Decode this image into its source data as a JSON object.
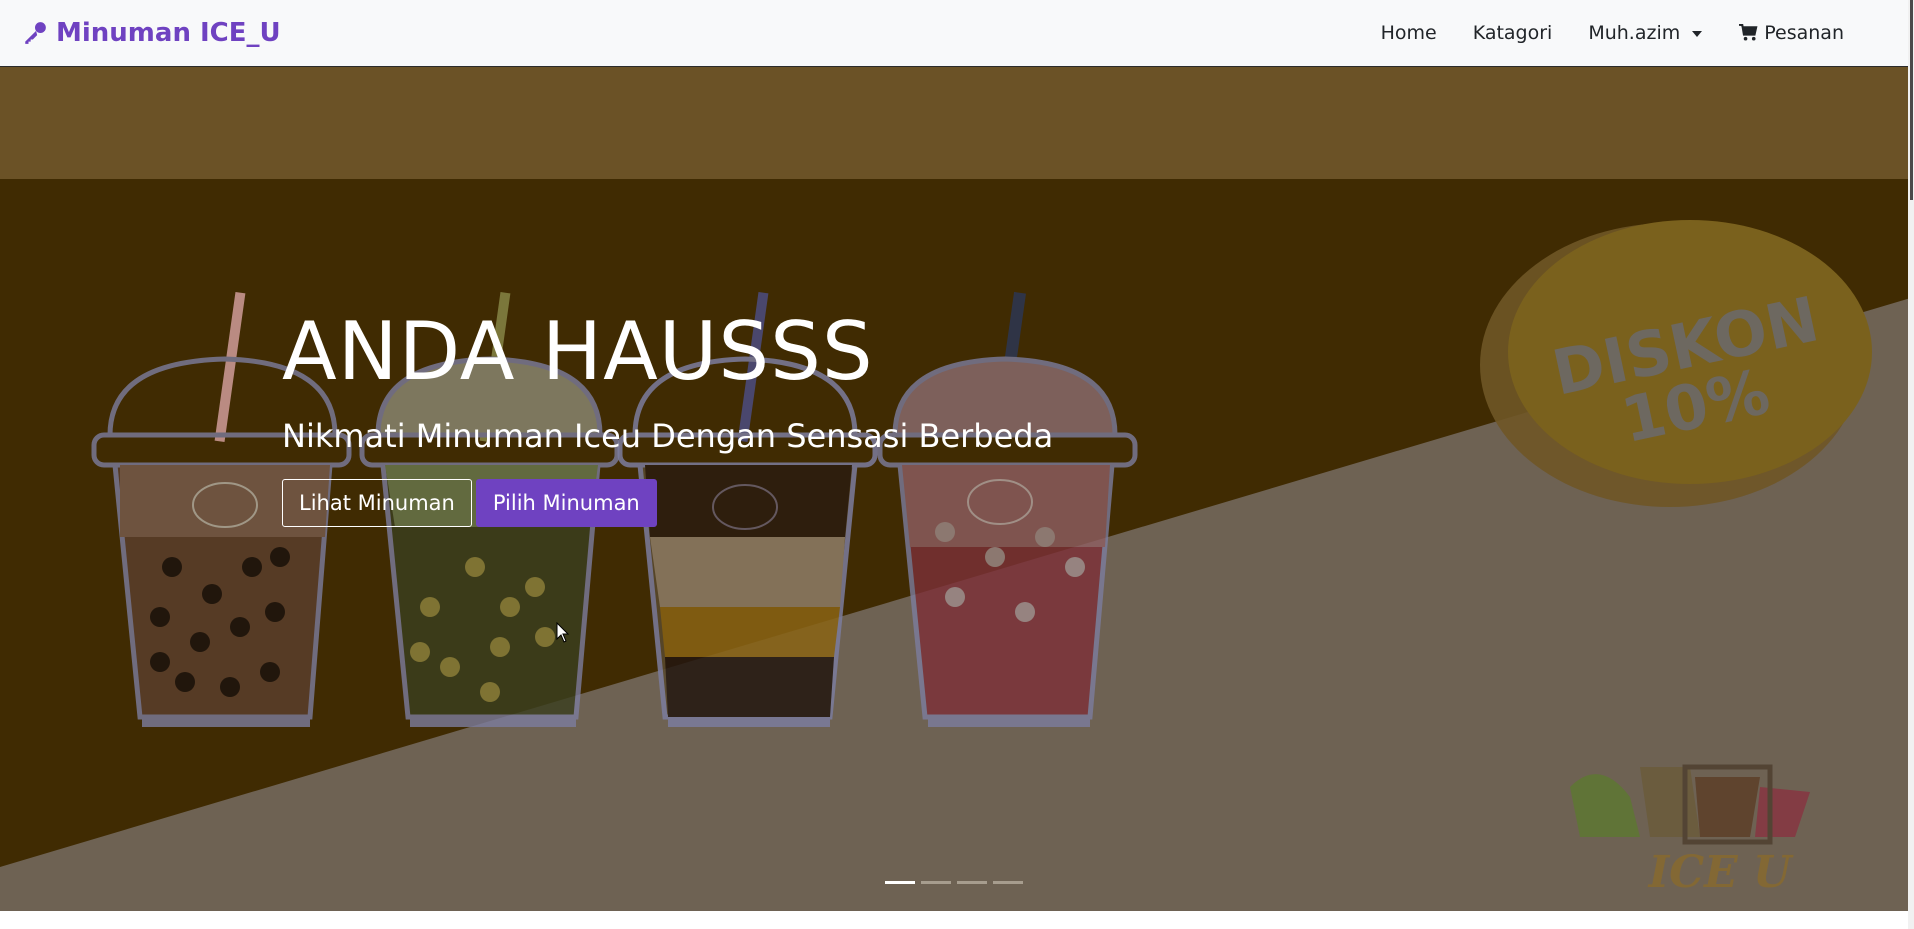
{
  "navbar": {
    "brand": "Minuman ICE_U",
    "brand_icon": "key-icon",
    "links": {
      "home": "Home",
      "category": "Katagori",
      "user": "Muh.azim",
      "orders": "Pesanan"
    },
    "orders_icon": "cart-icon",
    "colors": {
      "brand": "#6f42c1",
      "background": "#f8f9fa"
    }
  },
  "hero": {
    "headline": "ANDA HAUSSS",
    "subline": "Nikmati Minuman Iceu Dengan Sensasi Berbeda",
    "buttons": {
      "view": "Lihat Minuman",
      "choose": "Pilih Minuman"
    },
    "badge": {
      "line1": "DISKON",
      "line2": "10%"
    },
    "logo_text": "ICE U",
    "slides_total": 4,
    "slide_active": 1,
    "colors": {
      "dark": "#402b02",
      "band": "#6b5226",
      "light": "#6e6253",
      "accent": "#6f42c1"
    }
  }
}
